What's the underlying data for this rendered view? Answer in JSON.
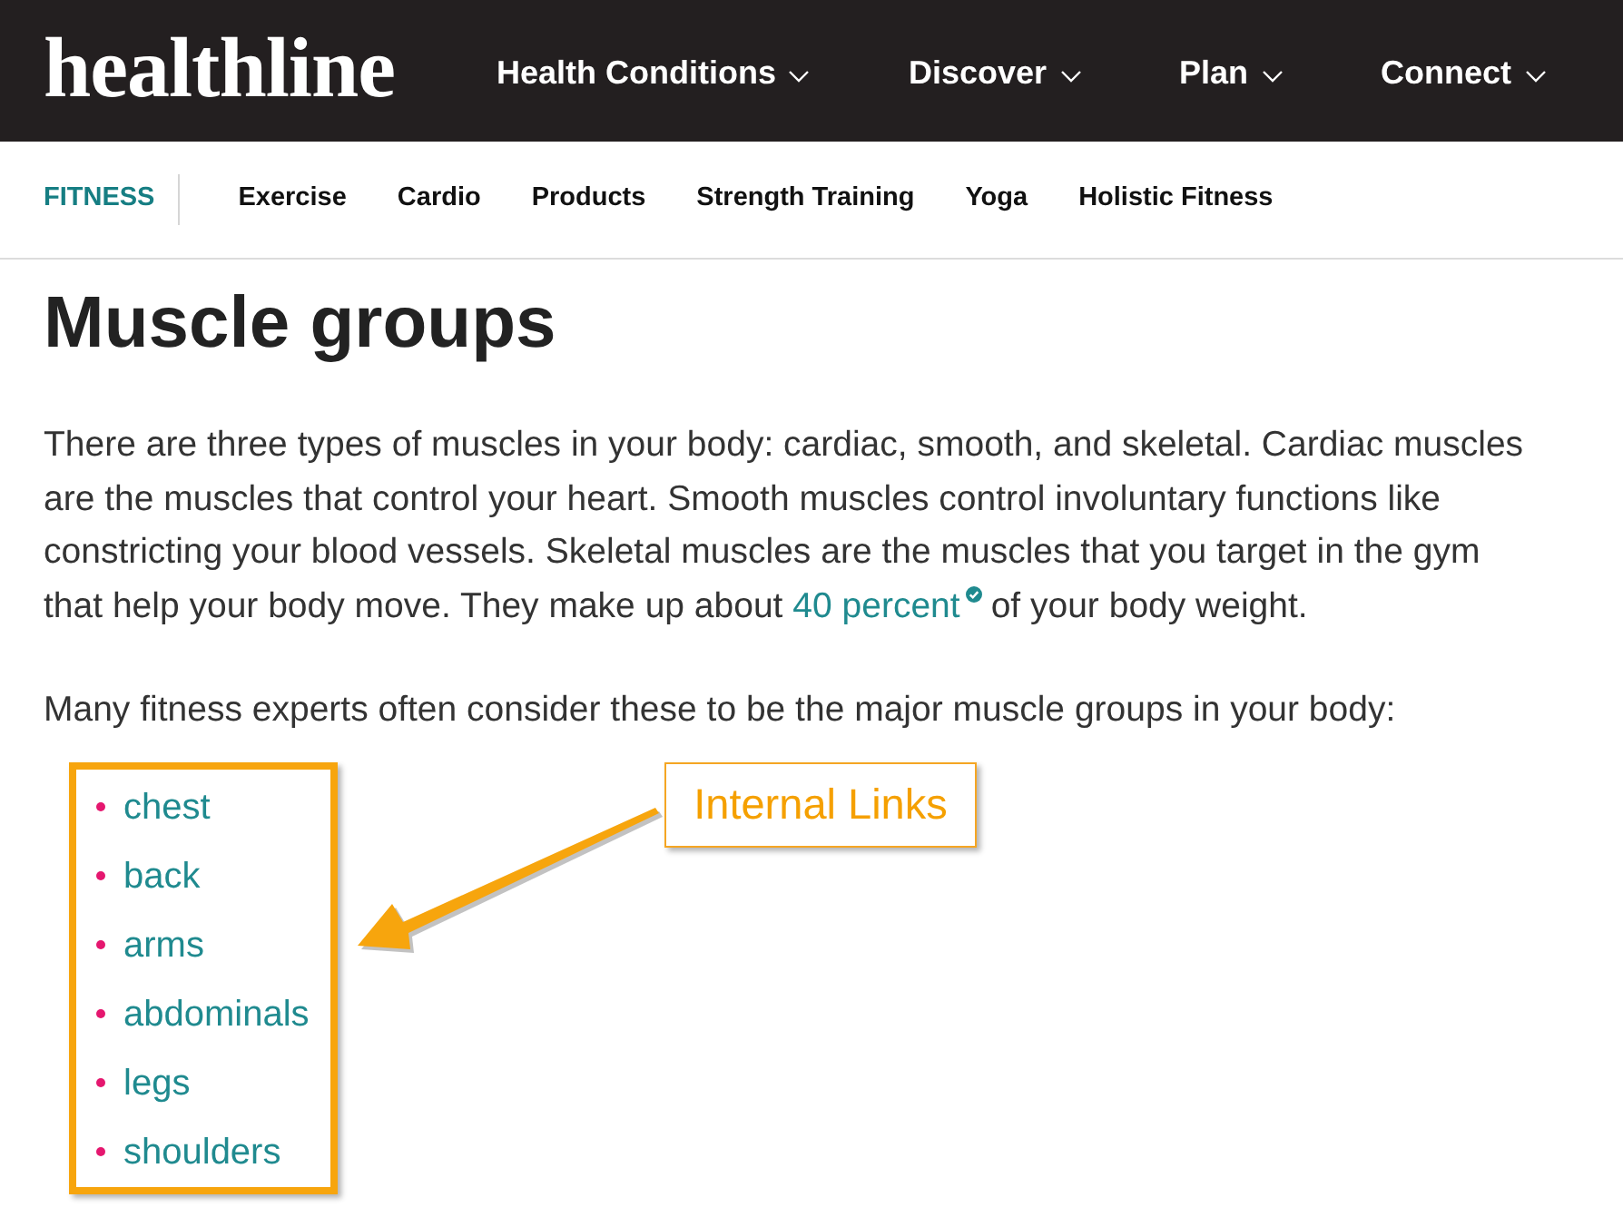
{
  "header": {
    "logo": "healthline",
    "nav": [
      {
        "label": "Health Conditions"
      },
      {
        "label": "Discover"
      },
      {
        "label": "Plan"
      },
      {
        "label": "Connect"
      }
    ]
  },
  "subnav": {
    "section": "FITNESS",
    "items": [
      "Exercise",
      "Cardio",
      "Products",
      "Strength Training",
      "Yoga",
      "Holistic Fitness"
    ]
  },
  "article": {
    "heading": "Muscle groups",
    "intro": {
      "text": "There are three types of muscles in your body: cardiac, smooth, and skeletal. Cardiac muscles are the muscles that control your heart. Smooth muscles control involuntary functions like constricting your blood vessels. Skeletal muscles are the muscles that you target in the gym that help your body move. They make up about",
      "link": "40 percent",
      "after": "of your body weight."
    },
    "lead": "Many fitness experts often consider these to be the major muscle groups in your body:",
    "muscle_groups": [
      "chest",
      "back",
      "arms",
      "abdominals",
      "legs",
      "shoulders"
    ]
  },
  "annotation": {
    "label": "Internal Links"
  }
}
